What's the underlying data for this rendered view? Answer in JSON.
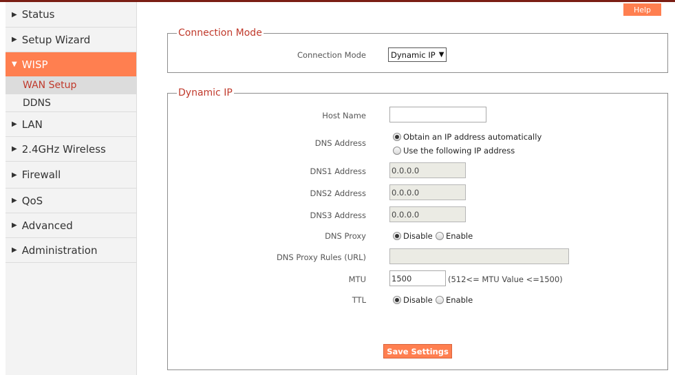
{
  "sidebar": {
    "items": [
      {
        "label": "Status"
      },
      {
        "label": "Setup Wizard"
      },
      {
        "label": "WISP"
      },
      {
        "label": "LAN"
      },
      {
        "label": "2.4GHz Wireless"
      },
      {
        "label": "Firewall"
      },
      {
        "label": "QoS"
      },
      {
        "label": "Advanced"
      },
      {
        "label": "Administration"
      }
    ],
    "wisp_sub": [
      {
        "label": "WAN Setup"
      },
      {
        "label": "DDNS"
      }
    ]
  },
  "header": {
    "help_label": "Help"
  },
  "connection_mode": {
    "legend": "Connection Mode",
    "label": "Connection Mode",
    "selected": "Dynamic IP"
  },
  "dynamic_ip": {
    "legend": "Dynamic IP",
    "host_name": {
      "label": "Host Name",
      "value": ""
    },
    "dns_address": {
      "label": "DNS  Address",
      "option_auto": "Obtain an IP address automatically",
      "option_manual": "Use the following IP address"
    },
    "dns1": {
      "label": "DNS1  Address",
      "value": "0.0.0.0"
    },
    "dns2": {
      "label": "DNS2  Address",
      "value": "0.0.0.0"
    },
    "dns3": {
      "label": "DNS3  Address",
      "value": "0.0.0.0"
    },
    "dns_proxy": {
      "label": "DNS Proxy",
      "disable": "Disable",
      "enable": "Enable"
    },
    "dns_proxy_rules": {
      "label": "DNS Proxy Rules (URL)",
      "value": ""
    },
    "mtu": {
      "label": "MTU",
      "value": "1500",
      "hint": "(512<= MTU  Value <=1500)"
    },
    "ttl": {
      "label": "TTL",
      "disable": "Disable",
      "enable": "Enable"
    },
    "save_label": "Save Settings"
  },
  "colors": {
    "accent": "#ff7f50",
    "legend": "#c0392b",
    "topbar": "#7a1e14"
  }
}
